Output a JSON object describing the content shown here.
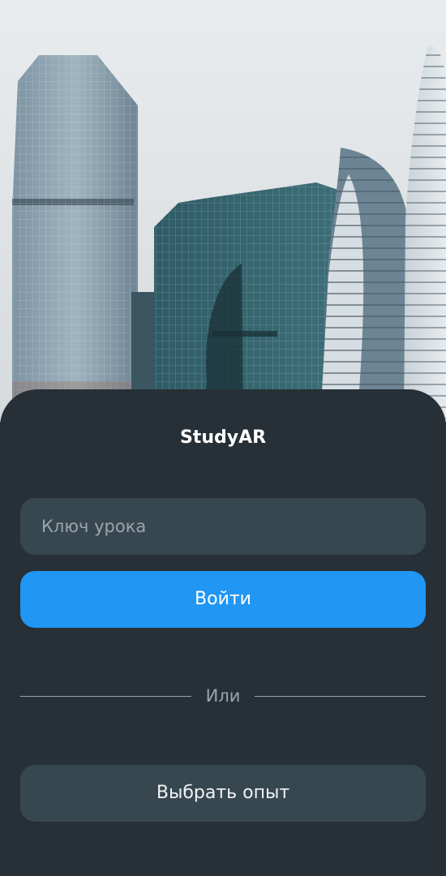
{
  "app": {
    "title": "StudyAR"
  },
  "login": {
    "key_placeholder": "Ключ урока",
    "submit_label": "Войти",
    "divider_label": "Или",
    "choose_experience_label": "Выбрать опыт"
  },
  "colors": {
    "sheet_background": "#263036",
    "field_background": "#37474f",
    "accent": "#2196f3",
    "muted_text": "#9aa5ab"
  }
}
